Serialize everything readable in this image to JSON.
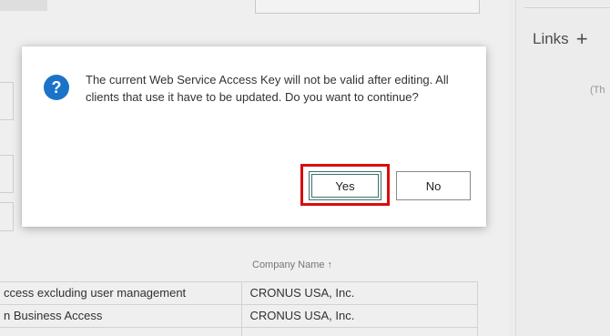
{
  "background": {
    "links_label": "Links",
    "links_add_icon": "plus-icon",
    "right_hint": "(Th",
    "table": {
      "header_company_name": "Company Name ↑",
      "rows": [
        {
          "permission": "ccess excluding user management",
          "company": "CRONUS USA, Inc."
        },
        {
          "permission": "n Business Access",
          "company": "CRONUS USA, Inc."
        }
      ]
    }
  },
  "dialog": {
    "icon": "question-icon",
    "message": "The current Web Service Access Key will not be valid after editing. All clients that use it have to be updated. Do you want to continue?",
    "yes_label": "Yes",
    "no_label": "No",
    "highlight_color": "#d90d0d",
    "icon_color": "#1a73c9"
  }
}
